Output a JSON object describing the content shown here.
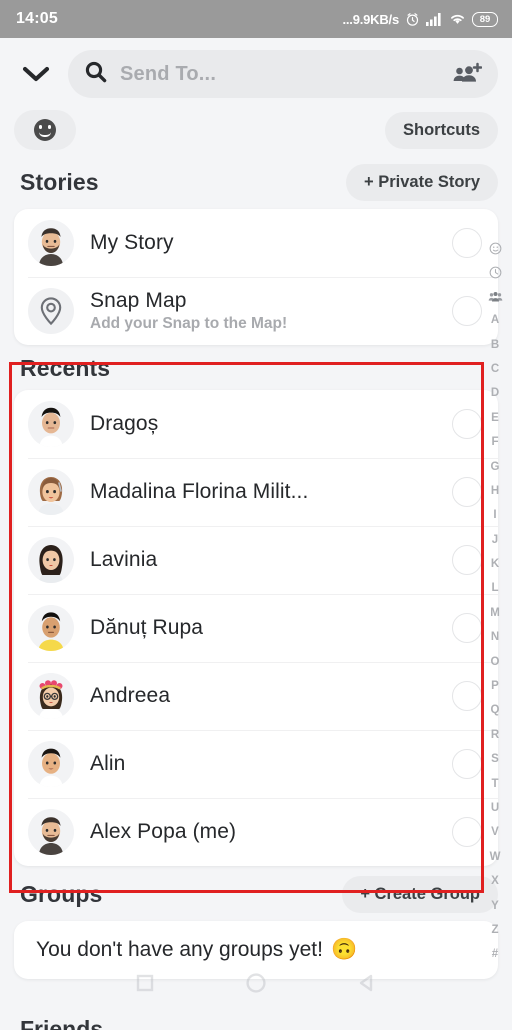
{
  "statusbar": {
    "time": "14:05",
    "network_speed": "...9.9KB/s",
    "alarm_icon": "alarm-clock-icon",
    "signal_icon": "cellular-signal-icon",
    "wifi_icon": "wifi-icon",
    "battery_level": "89"
  },
  "header": {
    "collapse_icon": "chevron-down-icon",
    "search_icon": "search-icon",
    "search_value": "",
    "search_placeholder": "Send To...",
    "add_friends_icon": "add-friends-icon"
  },
  "chips": {
    "emoji_chip_icon": "smiley-face-icon",
    "shortcuts_label": "Shortcuts"
  },
  "stories": {
    "title": "Stories",
    "private_story_label": "+ Private Story",
    "items": [
      {
        "title": "My Story",
        "subtitle": "",
        "avatar": "bitmoji-bearded-man",
        "selected": false
      },
      {
        "title": "Snap Map",
        "subtitle": "Add your Snap to the Map!",
        "avatar": "location-pin-icon",
        "selected": false
      }
    ]
  },
  "recents": {
    "title": "Recents",
    "items": [
      {
        "name": "Dragoș",
        "avatar": "bitmoji-dark-hair-man",
        "selected": false
      },
      {
        "name": "Madalina Florina Milit...",
        "avatar": "bitmoji-brown-hair-woman",
        "selected": false
      },
      {
        "name": "Lavinia",
        "avatar": "bitmoji-long-dark-hair-woman",
        "selected": false
      },
      {
        "name": "Dănuț Rupa",
        "avatar": "bitmoji-yellow-shirt-man",
        "selected": false
      },
      {
        "name": "Andreea",
        "avatar": "bitmoji-glasses-flower-crown-woman",
        "selected": false
      },
      {
        "name": "Alin",
        "avatar": "bitmoji-short-hair-man",
        "selected": false
      },
      {
        "name": "Alex Popa (me)",
        "avatar": "bitmoji-bearded-man",
        "selected": false
      }
    ]
  },
  "groups": {
    "title": "Groups",
    "create_group_label": "+ Create Group",
    "empty_text": "You don't have any groups yet!",
    "empty_emoji": "🙃"
  },
  "friends": {
    "title": "Friends"
  },
  "alpha_index": {
    "icons": [
      "smiley-index-icon",
      "clock-index-icon",
      "group-index-icon"
    ],
    "letters": [
      "A",
      "B",
      "C",
      "D",
      "E",
      "F",
      "G",
      "H",
      "I",
      "J",
      "K",
      "L",
      "M",
      "N",
      "O",
      "P",
      "Q",
      "R",
      "S",
      "T",
      "U",
      "V",
      "W",
      "X",
      "Y",
      "Z",
      "#"
    ]
  },
  "navbar": {
    "recents_icon": "square-icon",
    "home_icon": "circle-icon",
    "back_icon": "triangle-back-icon"
  },
  "annotation": {
    "color": "#e02020",
    "target": "recents-section"
  }
}
